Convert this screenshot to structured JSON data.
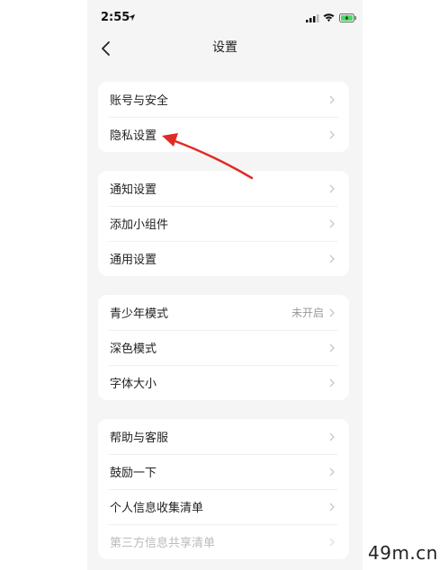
{
  "status_bar": {
    "time": "2:55",
    "icons": [
      "location-arrow-icon",
      "cellular-signal-icon",
      "wifi-icon",
      "battery-charging-icon"
    ]
  },
  "nav": {
    "title": "设置",
    "back_icon": "chevron-left-icon"
  },
  "groups": [
    {
      "items": [
        {
          "label": "账号与安全",
          "value": ""
        },
        {
          "label": "隐私设置",
          "value": ""
        }
      ]
    },
    {
      "items": [
        {
          "label": "通知设置",
          "value": ""
        },
        {
          "label": "添加小组件",
          "value": ""
        },
        {
          "label": "通用设置",
          "value": ""
        }
      ]
    },
    {
      "items": [
        {
          "label": "青少年模式",
          "value": "未开启"
        },
        {
          "label": "深色模式",
          "value": ""
        },
        {
          "label": "字体大小",
          "value": ""
        }
      ]
    },
    {
      "items": [
        {
          "label": "帮助与客服",
          "value": ""
        },
        {
          "label": "鼓励一下",
          "value": ""
        },
        {
          "label": "个人信息收集清单",
          "value": ""
        },
        {
          "label": "第三方信息共享清单",
          "value": ""
        }
      ]
    }
  ],
  "watermark": "49m.cn",
  "colors": {
    "background": "#f5f5f5",
    "card": "#ffffff",
    "annotation_arrow": "#e02b25",
    "chevron": "#c7c7cc",
    "value_text": "#999999"
  }
}
